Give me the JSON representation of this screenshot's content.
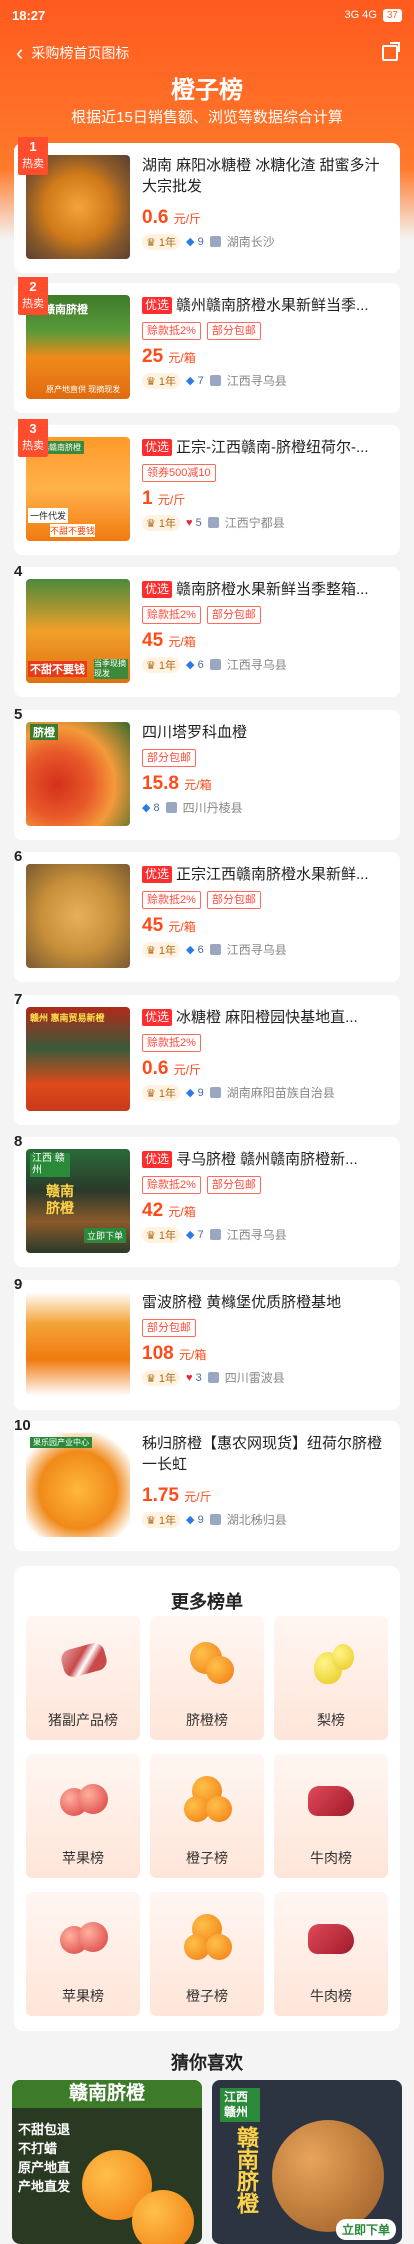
{
  "status": {
    "time": "18:27",
    "signal": "3G 4G",
    "battery": "37"
  },
  "nav": {
    "back_label": "采购榜首页图标"
  },
  "header": {
    "title": "橙子榜",
    "subtitle": "根据近15日销售额、浏览等数据综合计算"
  },
  "hot_label": "热卖",
  "items": [
    {
      "rank": "1",
      "hot": true,
      "select": "",
      "name": "湖南 麻阳冰糖橙 冰糖化渣 甜蜜多汁 大宗批发",
      "tags": [],
      "price": "0.6",
      "unit": "元/斤",
      "year": "1年",
      "score": "9",
      "score_icon": "diamond",
      "location": "湖南长沙"
    },
    {
      "rank": "2",
      "hot": true,
      "select": "优选",
      "name": "赣州赣南脐橙水果新鲜当季...",
      "tags": [
        "赊款抵2%",
        "部分包邮"
      ],
      "price": "25",
      "unit": "元/箱",
      "year": "1年",
      "score": "7",
      "score_icon": "diamond",
      "location": "江西寻乌县"
    },
    {
      "rank": "3",
      "hot": true,
      "select": "优选",
      "name": "正宗-江西赣南-脐橙纽荷尔-...",
      "tags": [
        "领券500减10"
      ],
      "price": "1",
      "unit": "元/斤",
      "year": "1年",
      "score": "5",
      "score_icon": "heart",
      "location": "江西宁都县"
    },
    {
      "rank": "4",
      "hot": false,
      "select": "优选",
      "name": "赣南脐橙水果新鲜当季整箱...",
      "tags": [
        "赊款抵2%",
        "部分包邮"
      ],
      "price": "45",
      "unit": "元/箱",
      "year": "1年",
      "score": "6",
      "score_icon": "diamond",
      "location": "江西寻乌县"
    },
    {
      "rank": "5",
      "hot": false,
      "select": "",
      "name": "四川塔罗科血橙",
      "tags": [
        "部分包邮"
      ],
      "price": "15.8",
      "unit": "元/箱",
      "year": "",
      "score": "8",
      "score_icon": "diamond",
      "location": "四川丹棱县"
    },
    {
      "rank": "6",
      "hot": false,
      "select": "优选",
      "name": "正宗江西赣南脐橙水果新鲜...",
      "tags": [
        "赊款抵2%",
        "部分包邮"
      ],
      "price": "45",
      "unit": "元/箱",
      "year": "1年",
      "score": "6",
      "score_icon": "diamond",
      "location": "江西寻乌县"
    },
    {
      "rank": "7",
      "hot": false,
      "select": "优选",
      "name": "冰糖橙 麻阳橙园快基地直...",
      "tags": [
        "赊款抵2%"
      ],
      "price": "0.6",
      "unit": "元/斤",
      "year": "1年",
      "score": "9",
      "score_icon": "diamond",
      "location": "湖南麻阳苗族自治县"
    },
    {
      "rank": "8",
      "hot": false,
      "select": "优选",
      "name": "寻乌脐橙 赣州赣南脐橙新...",
      "tags": [
        "赊款抵2%",
        "部分包邮"
      ],
      "price": "42",
      "unit": "元/箱",
      "year": "1年",
      "score": "7",
      "score_icon": "diamond",
      "location": "江西寻乌县"
    },
    {
      "rank": "9",
      "hot": false,
      "select": "",
      "name": "雷波脐橙 黄橼堡优质脐橙基地",
      "tags": [
        "部分包邮"
      ],
      "price": "108",
      "unit": "元/箱",
      "year": "1年",
      "score": "3",
      "score_icon": "heart",
      "location": "四川雷波县"
    },
    {
      "rank": "10",
      "hot": false,
      "select": "",
      "name": "秭归脐橙【惠农网现货】纽荷尔脐橙一长虹",
      "tags": [],
      "price": "1.75",
      "unit": "元/斤",
      "year": "1年",
      "score": "9",
      "score_icon": "diamond",
      "location": "湖北秭归县"
    }
  ],
  "thumb_texts": {
    "t2a": "赣南脐橙",
    "t2b": "原产地直供 现摘现发",
    "t3a": "精选赣南脐橙",
    "t3b": "一件代发",
    "t3c": "不甜不要钱",
    "t4a": "不甜不要钱",
    "t4b": "当季现摘现发",
    "t5a": "脐橙",
    "t7a": "赣州 惠南贸易新橙",
    "t8a": "江西 赣州",
    "t8b": "赣南脐橙",
    "t8c": "立即下单",
    "t10a": "果乐园产业中心"
  },
  "more": {
    "title": "更多榜单",
    "tiles": [
      {
        "label": "猪副产品榜",
        "icon": "pork-icon"
      },
      {
        "label": "脐橙榜",
        "icon": "navel-orange-icon"
      },
      {
        "label": "梨榜",
        "icon": "pear-icon"
      },
      {
        "label": "苹果榜",
        "icon": "apple-icon"
      },
      {
        "label": "橙子榜",
        "icon": "orange-icon"
      },
      {
        "label": "牛肉榜",
        "icon": "beef-icon"
      },
      {
        "label": "苹果榜",
        "icon": "apple-icon"
      },
      {
        "label": "橙子榜",
        "icon": "orange-icon"
      },
      {
        "label": "牛肉榜",
        "icon": "beef-icon"
      }
    ]
  },
  "guess": {
    "title": "猜你喜欢",
    "card1_title": "赣南脐橙",
    "card1_lines": [
      "不甜包退",
      "不打蜡",
      "原产地直",
      "产地直发"
    ],
    "card2_tag": "江西 赣州",
    "card2_title": "赣南脐橙",
    "card2_btn": "立即下单"
  },
  "colors": {
    "accent": "#ff5a1f",
    "price": "#ff4a1a",
    "select_badge": "#ff2d2d"
  }
}
